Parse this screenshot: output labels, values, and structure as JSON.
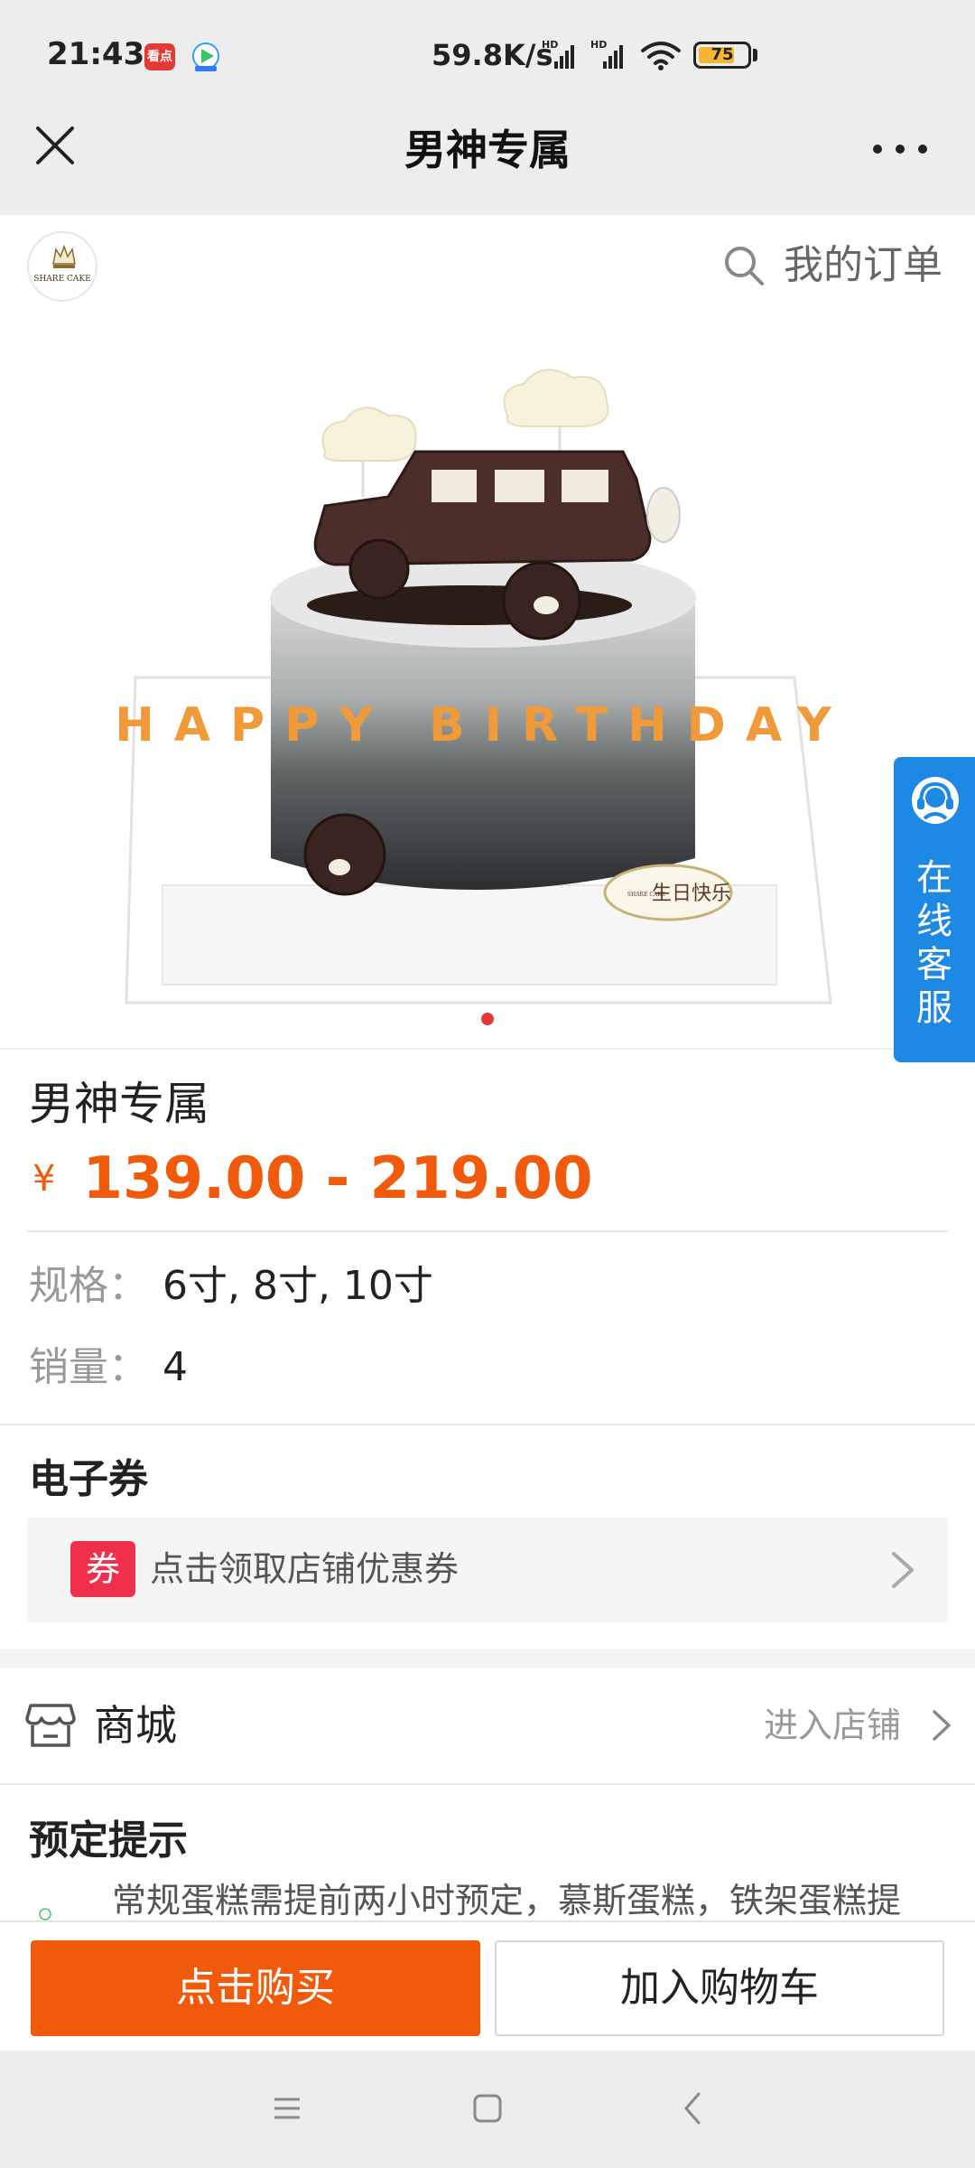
{
  "status_bar": {
    "time": "21:43",
    "app_badge_1": "看点",
    "net_speed": "59.8K/s",
    "battery": "75",
    "battery_level": 0.75,
    "battery_color": "#f5b731"
  },
  "title_bar": {
    "title": "男神专属",
    "close_icon": "close-icon",
    "more_icon": "more-dots-icon"
  },
  "shop": {
    "logo_text": "SHARE CAKE",
    "orders_label": "我的订单"
  },
  "carousel": {
    "cake_text": "HAPPY BIRTHDAY",
    "plaque_text": "生日快乐",
    "plaque_brand": "SHARE CAKE",
    "active_dot_color": "#e53935"
  },
  "customer_service": {
    "label": "在线客服"
  },
  "product": {
    "name": "男神专属",
    "currency": "¥",
    "price_range": "139.00 - 219.00",
    "price_color": "#f05a0a",
    "spec_label": "规格：",
    "spec_value": "6寸, 8寸, 10寸",
    "sales_label": "销量：",
    "sales_value": "4"
  },
  "coupon": {
    "section_title": "电子券",
    "badge": "券",
    "text": "点击领取店铺优惠券"
  },
  "mall": {
    "label": "商城",
    "enter_shop": "进入店铺"
  },
  "notice": {
    "title": "预定提示",
    "text": "常规蛋糕需提前两小时预定，慕斯蛋糕，铁架蛋糕提"
  },
  "actions": {
    "buy": "点击购买",
    "add_cart": "加入购物车",
    "buy_color": "#f05a0a"
  }
}
